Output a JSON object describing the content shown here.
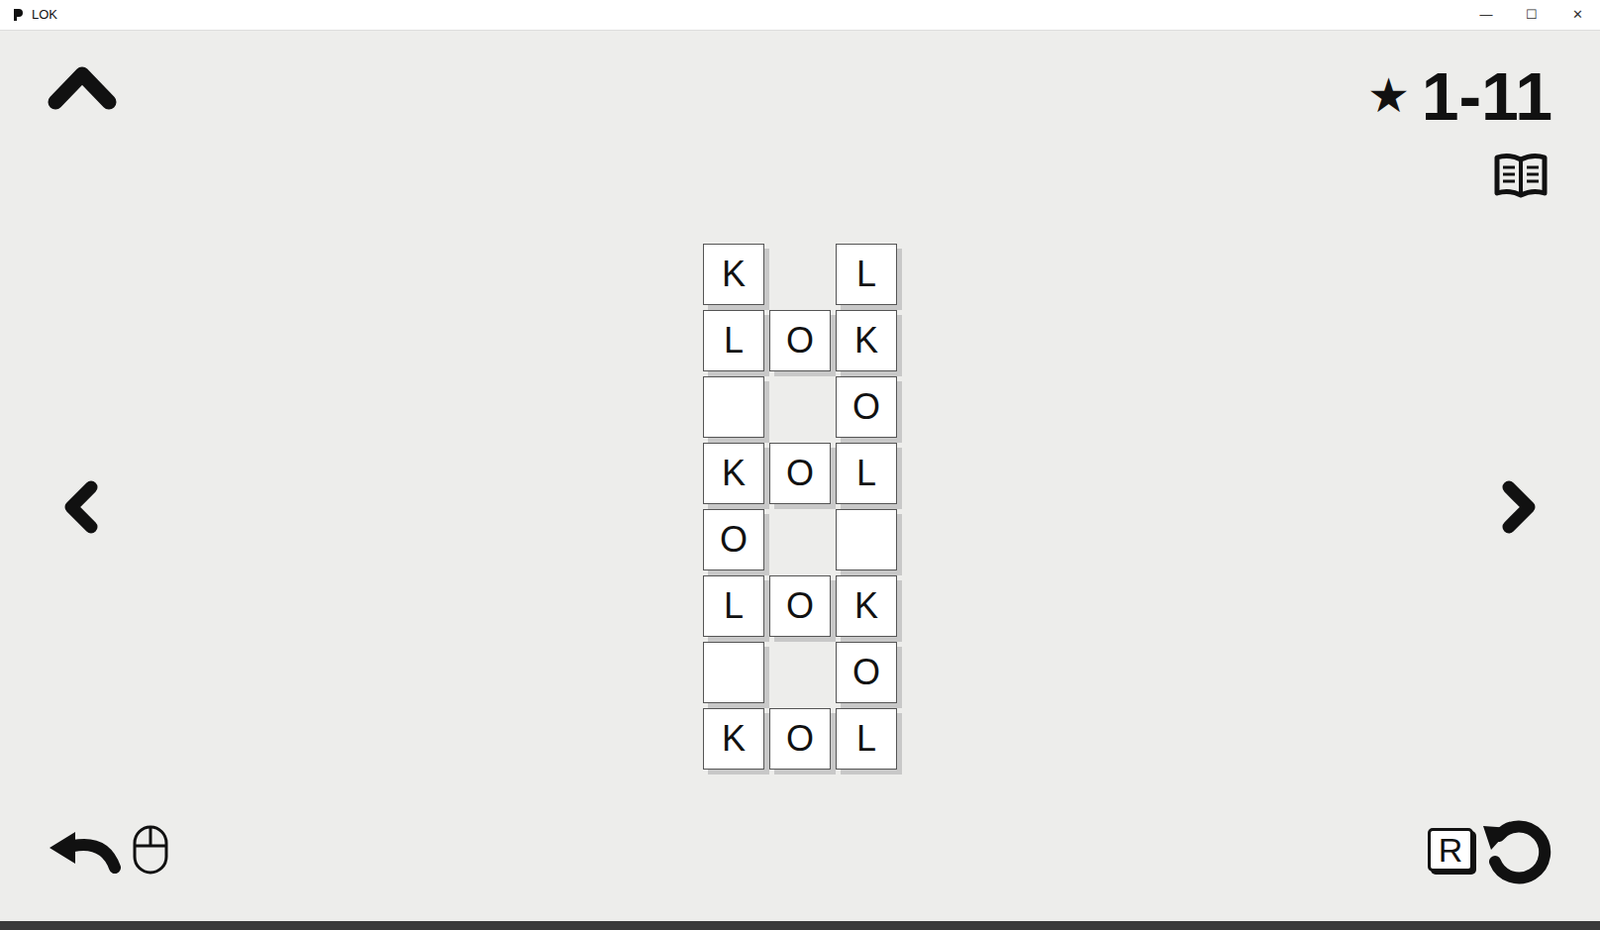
{
  "window": {
    "title": "LOK",
    "controls": [
      "—",
      "☐",
      "✕"
    ]
  },
  "level": {
    "star": "★",
    "label": "1-11"
  },
  "board": {
    "rows": [
      [
        {
          "kind": "letter",
          "letter": "K"
        },
        {
          "kind": "empty"
        },
        {
          "kind": "letter",
          "letter": "L"
        }
      ],
      [
        {
          "kind": "letter",
          "letter": "L"
        },
        {
          "kind": "letter",
          "letter": "O"
        },
        {
          "kind": "letter",
          "letter": "K"
        }
      ],
      [
        {
          "kind": "blank"
        },
        {
          "kind": "empty"
        },
        {
          "kind": "letter",
          "letter": "O"
        }
      ],
      [
        {
          "kind": "letter",
          "letter": "K"
        },
        {
          "kind": "letter",
          "letter": "O"
        },
        {
          "kind": "letter",
          "letter": "L"
        }
      ],
      [
        {
          "kind": "letter",
          "letter": "O"
        },
        {
          "kind": "empty"
        },
        {
          "kind": "blank"
        }
      ],
      [
        {
          "kind": "letter",
          "letter": "L"
        },
        {
          "kind": "letter",
          "letter": "O"
        },
        {
          "kind": "letter",
          "letter": "K"
        }
      ],
      [
        {
          "kind": "blank"
        },
        {
          "kind": "empty"
        },
        {
          "kind": "letter",
          "letter": "O"
        }
      ],
      [
        {
          "kind": "letter",
          "letter": "K"
        },
        {
          "kind": "letter",
          "letter": "O"
        },
        {
          "kind": "letter",
          "letter": "L"
        }
      ]
    ]
  },
  "restart_key": "R"
}
